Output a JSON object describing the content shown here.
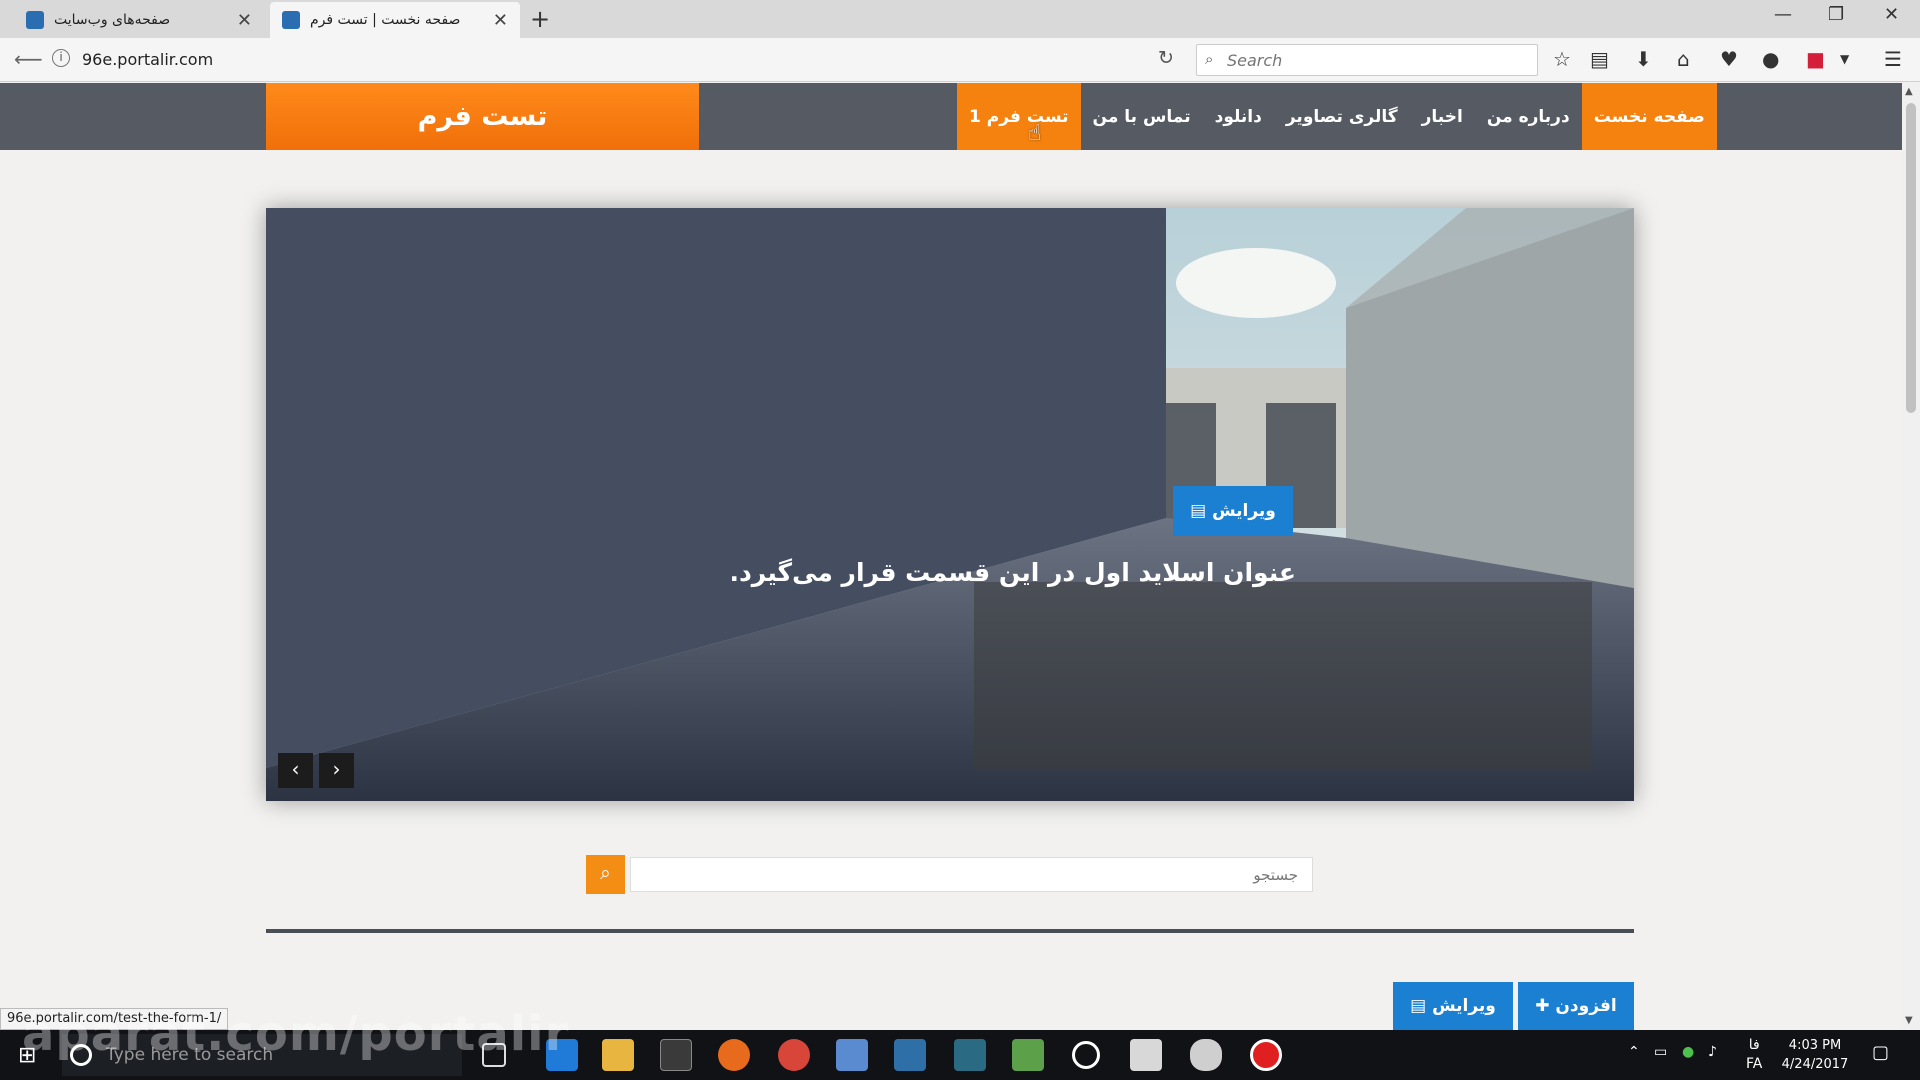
{
  "browser": {
    "tabs": [
      {
        "title": "صفحه‌های وب‌سایت",
        "active": false
      },
      {
        "title": "صفحه نخست | تست فرم",
        "active": true
      }
    ],
    "new_tab_icon": "+",
    "url": "96e.portalir.com",
    "search_placeholder": "Search",
    "status_url": "96e.portalir.com/test-the-form-1/"
  },
  "site": {
    "brand": "تست فرم",
    "menu": [
      {
        "label": "تست فرم 1",
        "highlighted": true
      },
      {
        "label": "تماس با من",
        "highlighted": false
      },
      {
        "label": "دانلود",
        "highlighted": false
      },
      {
        "label": "گالری تصاویر",
        "highlighted": false
      },
      {
        "label": "اخبار",
        "highlighted": false
      },
      {
        "label": "درباره من",
        "highlighted": false
      },
      {
        "label": "صفحه نخست",
        "highlighted": true
      }
    ],
    "slider": {
      "edit_label": "ویرایش",
      "title": "عنوان اسلاید اول در این قسمت قرار می‌گیرد.",
      "prev_icon": "‹",
      "next_icon": "›"
    },
    "search_placeholder": "جستجو",
    "buttons": {
      "edit_label": "ویرایش",
      "add_label": "افزودن"
    }
  },
  "taskbar": {
    "search_placeholder": "Type here to search",
    "time": "4:03 PM",
    "date": "4/24/2017",
    "lang_top": "فا",
    "lang_bottom": "FA"
  },
  "watermark": "aparat.com/portalir",
  "colors": {
    "accent_orange": "#f5820f",
    "header_gray": "#565b63",
    "button_blue": "#1b7fd2"
  }
}
